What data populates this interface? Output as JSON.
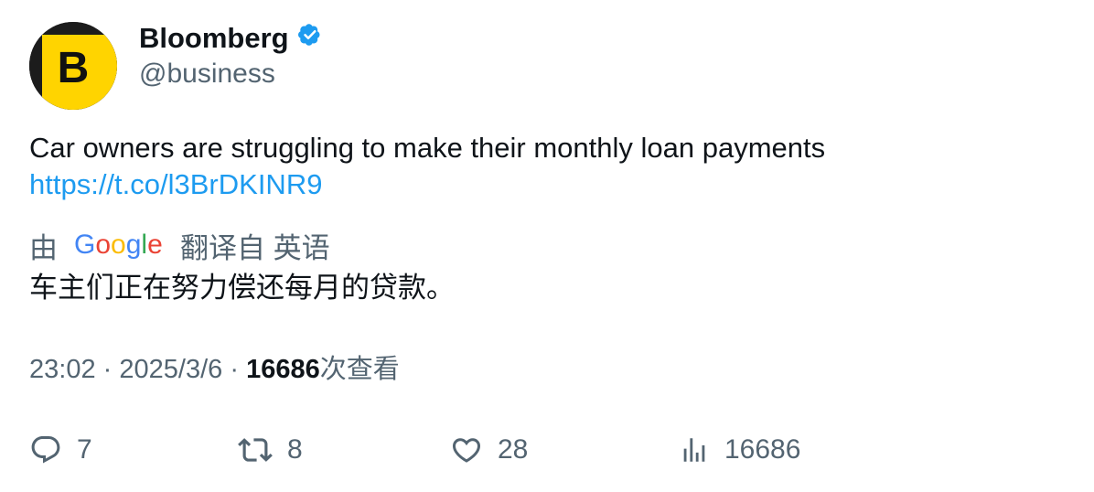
{
  "author": {
    "name": "Bloomberg",
    "handle": "@business",
    "avatar_letter": "B",
    "verified_icon": "verified-badge-icon",
    "brand_color": "#ffd700"
  },
  "tweet": {
    "text": "Car owners are struggling to make their monthly loan payments",
    "link": "https://t.co/l3BrDKINR9",
    "link_color": "#1d9bf0"
  },
  "translation": {
    "prefix": "由",
    "provider": "Google",
    "suffix": "翻译自 英语",
    "text": "车主们正在努力偿还每月的贷款。"
  },
  "meta": {
    "time": "23:02",
    "separator": "·",
    "date": "2025/3/6",
    "views": "16686",
    "views_label": "次查看"
  },
  "actions": {
    "replies": {
      "icon": "reply-icon",
      "count": "7"
    },
    "retweets": {
      "icon": "retweet-icon",
      "count": "8"
    },
    "likes": {
      "icon": "heart-icon",
      "count": "28"
    },
    "views": {
      "icon": "analytics-icon",
      "count": "16686"
    }
  }
}
